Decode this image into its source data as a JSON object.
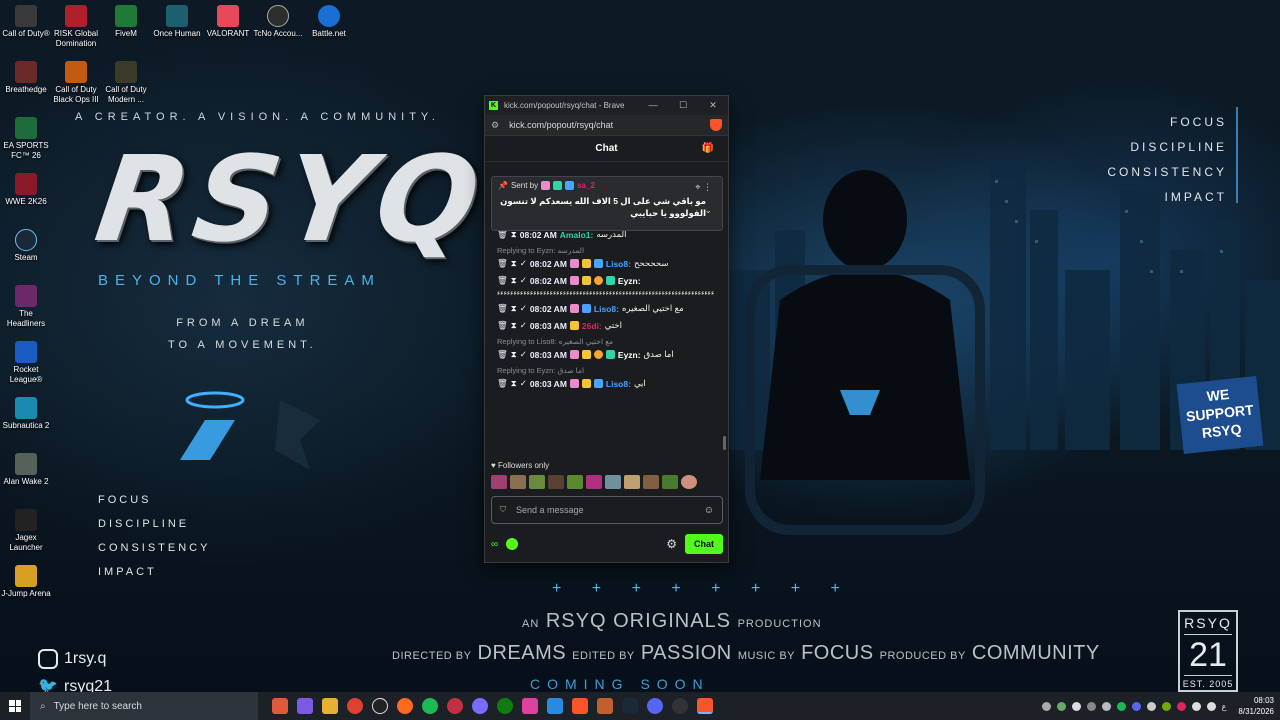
{
  "wallpaper": {
    "tagline": "A CREATOR. A VISION. A COMMUNITY.",
    "title": "RSYQ",
    "subtitle": "BEYOND THE STREAM",
    "dream_line1": "FROM A DREAM",
    "dream_line2": "TO A MOVEMENT.",
    "values": [
      "FOCUS",
      "DISCIPLINE",
      "CONSISTENCY",
      "IMPACT"
    ],
    "plus_row": "+ + + + + + + +",
    "production": {
      "an": "AN",
      "name": "RSYQ ORIGINALS",
      "suffix": "PRODUCTION"
    },
    "credits": {
      "directed_by": "DIRECTED BY",
      "directed_val": "DREAMS",
      "edited_by": "EDITED BY",
      "edited_val": "PASSION",
      "music_by": "MUSIC BY",
      "music_val": "FOCUS",
      "produced_by": "PRODUCED BY",
      "produced_val": "COMMUNITY"
    },
    "coming_soon": "COMING SOON",
    "social_instagram": "1rsy.q",
    "social_twitter": "rsyq21",
    "sign": "WE SUPPORT RSYQ",
    "badge": {
      "top": "RSYQ",
      "num": "21",
      "est": "EST. 2005"
    }
  },
  "desktop_icons": [
    {
      "label": "Call of Duty®",
      "color": "#3a3a3a"
    },
    {
      "label": "RISK Global Domination",
      "color": "#b0202a"
    },
    {
      "label": "FiveM",
      "color": "#1f7a3a"
    },
    {
      "label": "Once Human",
      "color": "#1c5f6e"
    },
    {
      "label": "VALORANT",
      "color": "#e8485a"
    },
    {
      "label": "TcNo Accou...",
      "color": "#2d2d2d"
    },
    {
      "label": "Battle.net",
      "color": "#1a6fd6"
    },
    {
      "label": "Breathedge",
      "color": "#6a2a2a"
    },
    {
      "label": "Call of Duty Black Ops III",
      "color": "#c25a12"
    },
    {
      "label": "Call of Duty Modern ...",
      "color": "#3b3b2a"
    },
    {
      "label": "EA SPORTS FC™ 26",
      "color": "#1e6b3c"
    },
    {
      "label": "WWE 2K26",
      "color": "#8a1a2a"
    },
    {
      "label": "Steam",
      "color": "#1b2838"
    },
    {
      "label": "The Headliners",
      "color": "#6a2a6a"
    },
    {
      "label": "Rocket League®",
      "color": "#1a5cc2"
    },
    {
      "label": "Subnautica 2",
      "color": "#1a8ab0"
    },
    {
      "label": "Alan Wake 2",
      "color": "#55625a"
    },
    {
      "label": "Jagex Launcher",
      "color": "#222"
    },
    {
      "label": "J-Jump Arena",
      "color": "#d8a020"
    }
  ],
  "browser": {
    "window_title": "kick.com/popout/rsyq/chat - Brave",
    "url": "kick.com/popout/rsyq/chat",
    "chat_title": "Chat",
    "pinned": {
      "sent_by": "Sent by",
      "user": "sa_2",
      "message": "مو باقي شي على ال 5 الاف الله يسعدكم لا تنسون الفولووو يا حبايبي"
    },
    "messages": [
      {
        "reply": "",
        "time": "08:02 AM",
        "user": "Amalo1:",
        "user_color": "#2fd4a8",
        "text": "المدرسه"
      },
      {
        "reply": "Replying to Eyzn: المدرسه",
        "time": "08:02 AM",
        "user": "Liso8:",
        "user_color": "#4aa3ff",
        "text": "سححححح"
      },
      {
        "reply": "",
        "time": "08:02 AM",
        "user": "Eyzn:",
        "user_color": "#ffffff",
        "text": "ءءءءءءءءءءءءءءءءءءءءءءءءءءءءءءءءءءءءءءءءءءءءءءءءءءءءءءءءءءءءءءءءءء"
      },
      {
        "reply": "",
        "time": "08:02 AM",
        "user": "Liso8:",
        "user_color": "#4aa3ff",
        "text": "مع اختيي الصغيره"
      },
      {
        "reply": "",
        "time": "08:03 AM",
        "user": "26di:",
        "user_color": "#e0245e",
        "text": "اختي"
      },
      {
        "reply": "Replying to Liso8: مع اختيي الصغيره",
        "time": "08:03 AM",
        "user": "Eyzn:",
        "user_color": "#ffffff",
        "text": "اما صدق"
      },
      {
        "reply": "Replying to Eyzn: اما صدق",
        "time": "08:03 AM",
        "user": "Liso8:",
        "user_color": "#4aa3ff",
        "text": "ايي"
      }
    ],
    "followers_only": "Followers only",
    "input_placeholder": "Send a message",
    "chat_button": "Chat"
  },
  "taskbar": {
    "search_placeholder": "Type here to search",
    "lang": "ع",
    "time": "08:03",
    "date": "8/31/2026"
  },
  "colors": {
    "kick_green": "#53fc18",
    "accent_blue": "#4fb3e6"
  }
}
